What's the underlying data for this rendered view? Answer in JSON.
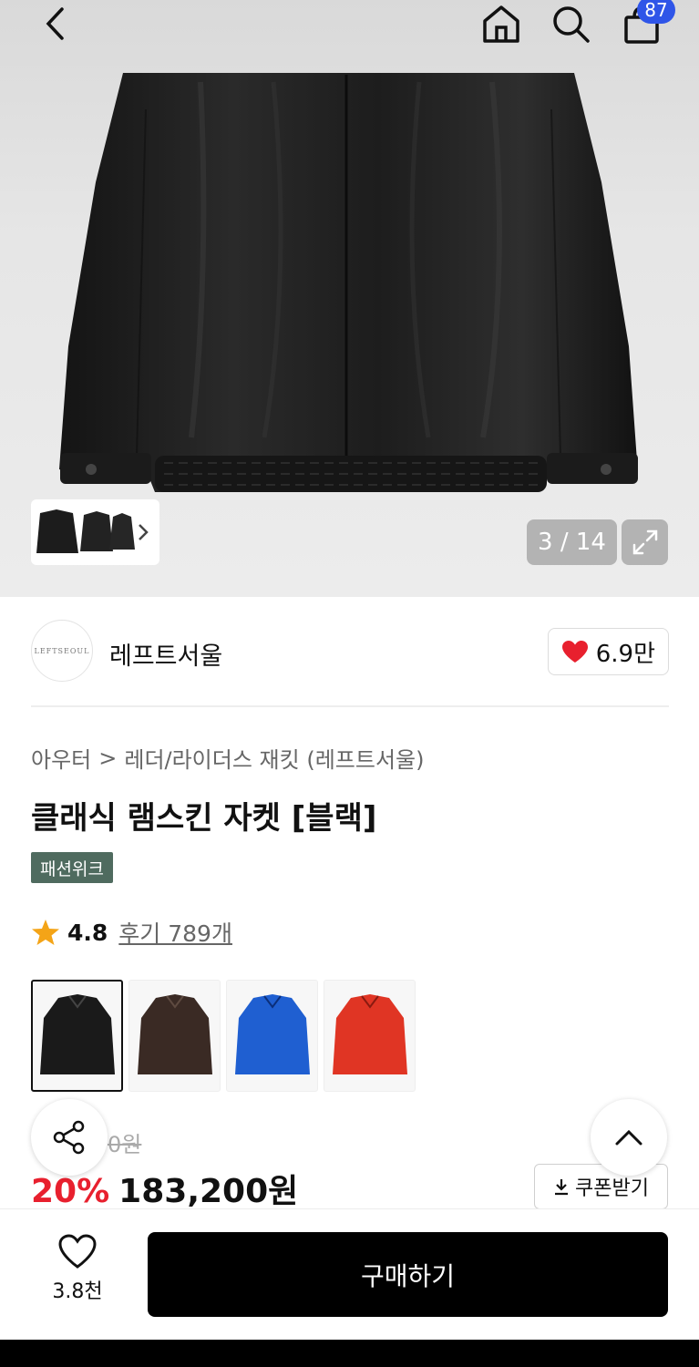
{
  "header": {
    "back_icon": "chevron-left-icon",
    "home_icon": "home-icon",
    "search_icon": "search-icon",
    "cart_icon": "shopping-bag-icon",
    "cart_count": "87"
  },
  "gallery": {
    "counter": "3 / 14",
    "current": 3,
    "total": 14,
    "expand_icon": "expand-icon",
    "thumb_more_icon": "chevron-right-icon"
  },
  "brand": {
    "logo_text": "LEFTSEOUL",
    "name": "레프트서울",
    "like_count": "6.9만",
    "like_icon": "heart-filled-icon",
    "like_color": "#e8202e"
  },
  "product": {
    "breadcrumb": [
      "아우터",
      "레더/라이더스 재킷 (레프트서울)"
    ],
    "title": "클래식 램스킨 자켓 [블랙]",
    "badge": "패션위크",
    "rating": "4.8",
    "reviews": "후기 789개",
    "swatches": [
      {
        "color": "#1a1a1a",
        "label": "black"
      },
      {
        "color": "#3a2a24",
        "label": "brown"
      },
      {
        "color": "#1f5fd1",
        "label": "blue"
      },
      {
        "color": "#e03524",
        "label": "red"
      }
    ],
    "original_price_fragment": "0원",
    "discount": "20%",
    "price": "183,200원",
    "coupon_label": "쿠폰받기"
  },
  "bottom_bar": {
    "wish_count": "3.8천",
    "buy_label": "구매하기"
  },
  "colors": {
    "accent_blue": "#2f55e8",
    "discount_red": "#e8202e",
    "badge_green": "#4f6b5f"
  }
}
